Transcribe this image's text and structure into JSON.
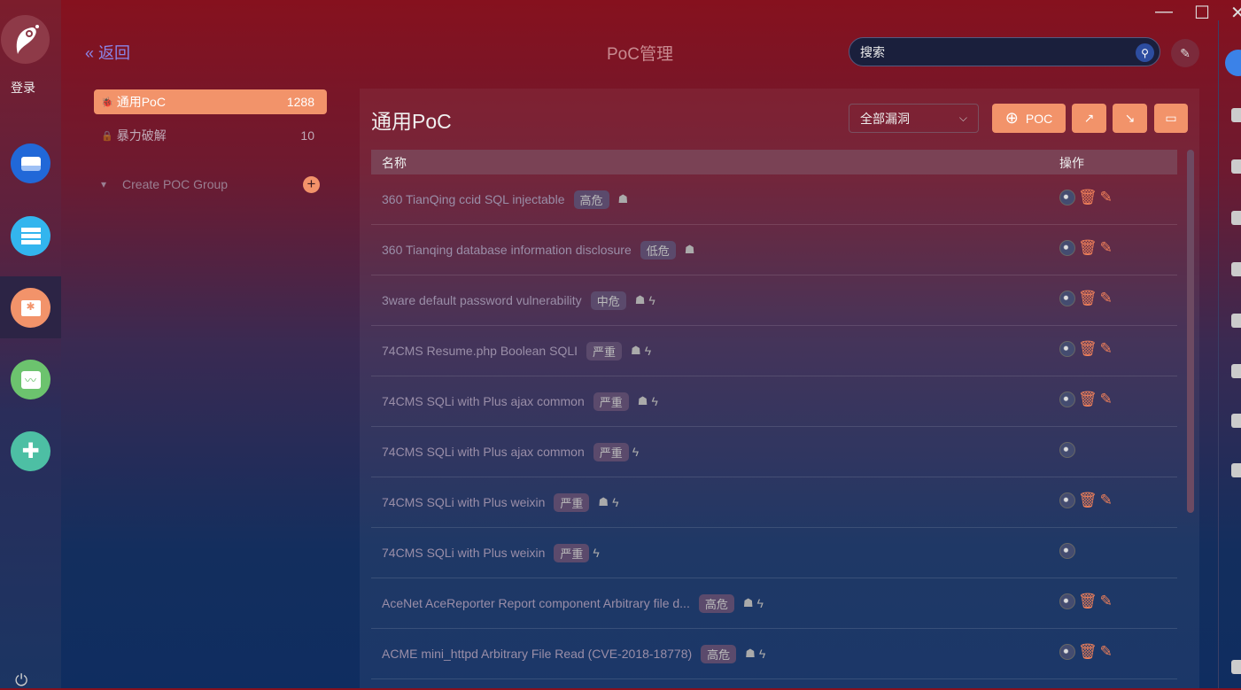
{
  "window": {
    "minimize": "—",
    "maximize": "☐",
    "close": "✕"
  },
  "rail": {
    "login": "登录",
    "power_icon": "⏻"
  },
  "header": {
    "back": "« 返回",
    "title": "PoC管理",
    "search_placeholder": "搜索",
    "search_icon": "⚲",
    "edit_icon": "✎"
  },
  "sidebar": {
    "items": [
      {
        "label": "通用PoC",
        "count": "1288",
        "icon": "🐞"
      },
      {
        "label": "暴力破解",
        "count": "10",
        "icon": "🔒"
      }
    ],
    "group": {
      "label": "Create POC Group",
      "caret": "▾",
      "add": "+"
    }
  },
  "main": {
    "title": "通用PoC",
    "filter": "全部漏洞",
    "filter_chev": "⌵",
    "add_poc": "POC",
    "add_icon": "⊕",
    "export_icon": "↗",
    "import_icon": "↘",
    "folder_icon": "▭",
    "columns": [
      "名称",
      "操作"
    ],
    "rows": [
      {
        "name": "360 TianQing ccid SQL injectable",
        "severity": "高危",
        "ghost": true,
        "bolt": false,
        "full": true
      },
      {
        "name": "360 Tianqing database information disclosure",
        "severity": "低危",
        "ghost": true,
        "bolt": false,
        "full": true
      },
      {
        "name": "3ware default password vulnerability",
        "severity": "中危",
        "ghost": true,
        "bolt": true,
        "full": true
      },
      {
        "name": "74CMS Resume.php Boolean SQLI",
        "severity": "严重",
        "ghost": true,
        "bolt": true,
        "full": true
      },
      {
        "name": "74CMS SQLi with Plus ajax common",
        "severity": "严重",
        "ghost": true,
        "bolt": true,
        "full": true
      },
      {
        "name": "74CMS SQLi with Plus ajax common",
        "severity": "严重",
        "ghost": false,
        "bolt": true,
        "full": false
      },
      {
        "name": "74CMS SQLi with Plus weixin",
        "severity": "严重",
        "ghost": true,
        "bolt": true,
        "full": true
      },
      {
        "name": "74CMS SQLi with Plus weixin",
        "severity": "严重",
        "ghost": false,
        "bolt": true,
        "full": false
      },
      {
        "name": "AceNet AceReporter Report component Arbitrary file d...",
        "severity": "高危",
        "ghost": true,
        "bolt": true,
        "full": true
      },
      {
        "name": "ACME mini_httpd Arbitrary File Read (CVE-2018-18778)",
        "severity": "高危",
        "ghost": true,
        "bolt": true,
        "full": true
      }
    ]
  },
  "icons": {
    "ghost": "☗",
    "bolt": "ϟ",
    "delete": "🗑",
    "edit": "✎"
  }
}
